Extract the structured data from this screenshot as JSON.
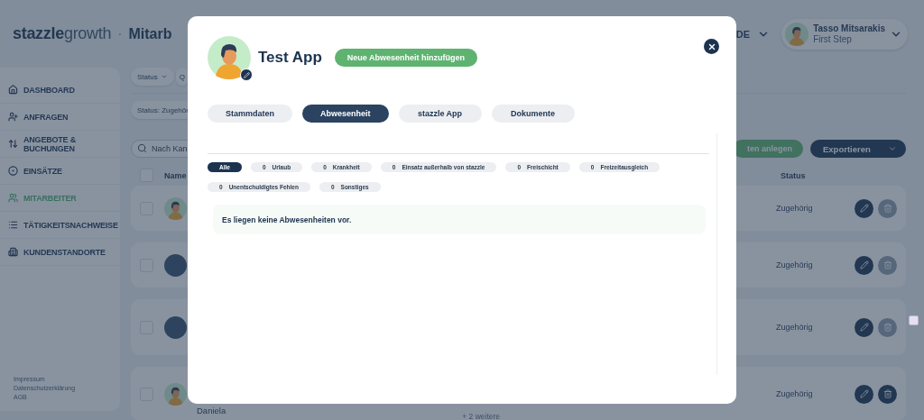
{
  "header": {
    "logo_bold": "stazzle",
    "logo_light": "growth",
    "separator": "·",
    "page_title": "Mitarb",
    "language": "DE",
    "user": {
      "name": "Tasso Mitsarakis",
      "company": "First Step"
    }
  },
  "sidebar": {
    "items": [
      {
        "label": "DASHBOARD",
        "selected": false
      },
      {
        "label": "ANFRAGEN",
        "selected": false
      },
      {
        "label": "ANGEBOTE & BUCHUNGEN",
        "selected": false
      },
      {
        "label": "EINSÄTZE",
        "selected": false
      },
      {
        "label": "MITARBEITER",
        "selected": true
      },
      {
        "label": "TÄTIGKEITSNACHWEISE",
        "selected": false
      },
      {
        "label": "KUNDENSTANDORTE",
        "selected": false
      }
    ],
    "footer_links": [
      "Impressum",
      "Datenschutzerklärung",
      "AGB"
    ]
  },
  "toolbar": {
    "filters": [
      "Status",
      "Q"
    ],
    "active_filter": "Status: Zugehör",
    "search_placeholder": "Nach Kan",
    "create_button": "ten anlegen",
    "export_button": "Exportieren"
  },
  "table": {
    "columns": [
      "Name",
      "Status"
    ],
    "select_all_checked": false,
    "rows": [
      {
        "kind": "illustration",
        "checked": false,
        "status": "Zugehörig",
        "delete_disabled": true
      },
      {
        "kind": "photo",
        "checked": false,
        "status": "Zugehörig",
        "delete_disabled": true
      },
      {
        "kind": "photo",
        "checked": false,
        "status": "Zugehörig",
        "delete_disabled": true
      },
      {
        "kind": "illustration",
        "checked": false,
        "name": "Daniela",
        "extra": "+ 2 weitere",
        "status": "Zugehörig",
        "delete_disabled": false
      }
    ]
  },
  "modal": {
    "title": "Test App",
    "add_button": "Neue Abwesenheit hinzufügen",
    "tabs": [
      {
        "label": "Stammdaten",
        "selected": false
      },
      {
        "label": "Abwesenheit",
        "selected": true
      },
      {
        "label": "stazzle App",
        "selected": false
      },
      {
        "label": "Dokumente",
        "selected": false
      }
    ],
    "filters": [
      {
        "label": "Alle",
        "selected": true
      },
      {
        "count": "0",
        "label": "Urlaub",
        "selected": false
      },
      {
        "count": "0",
        "label": "Krankheit",
        "selected": false
      },
      {
        "count": "0",
        "label": "Einsatz außerhalb von stazzle",
        "selected": false
      },
      {
        "count": "0",
        "label": "Freischicht",
        "selected": false
      },
      {
        "count": "0",
        "label": "Freizeitausgleich",
        "selected": false
      },
      {
        "count": "0",
        "label": "Unentschuldigtes Fehlen",
        "selected": false
      },
      {
        "count": "0",
        "label": "Sonstiges",
        "selected": false
      }
    ],
    "empty_message": "Es liegen keine Abwesenheiten vor."
  }
}
